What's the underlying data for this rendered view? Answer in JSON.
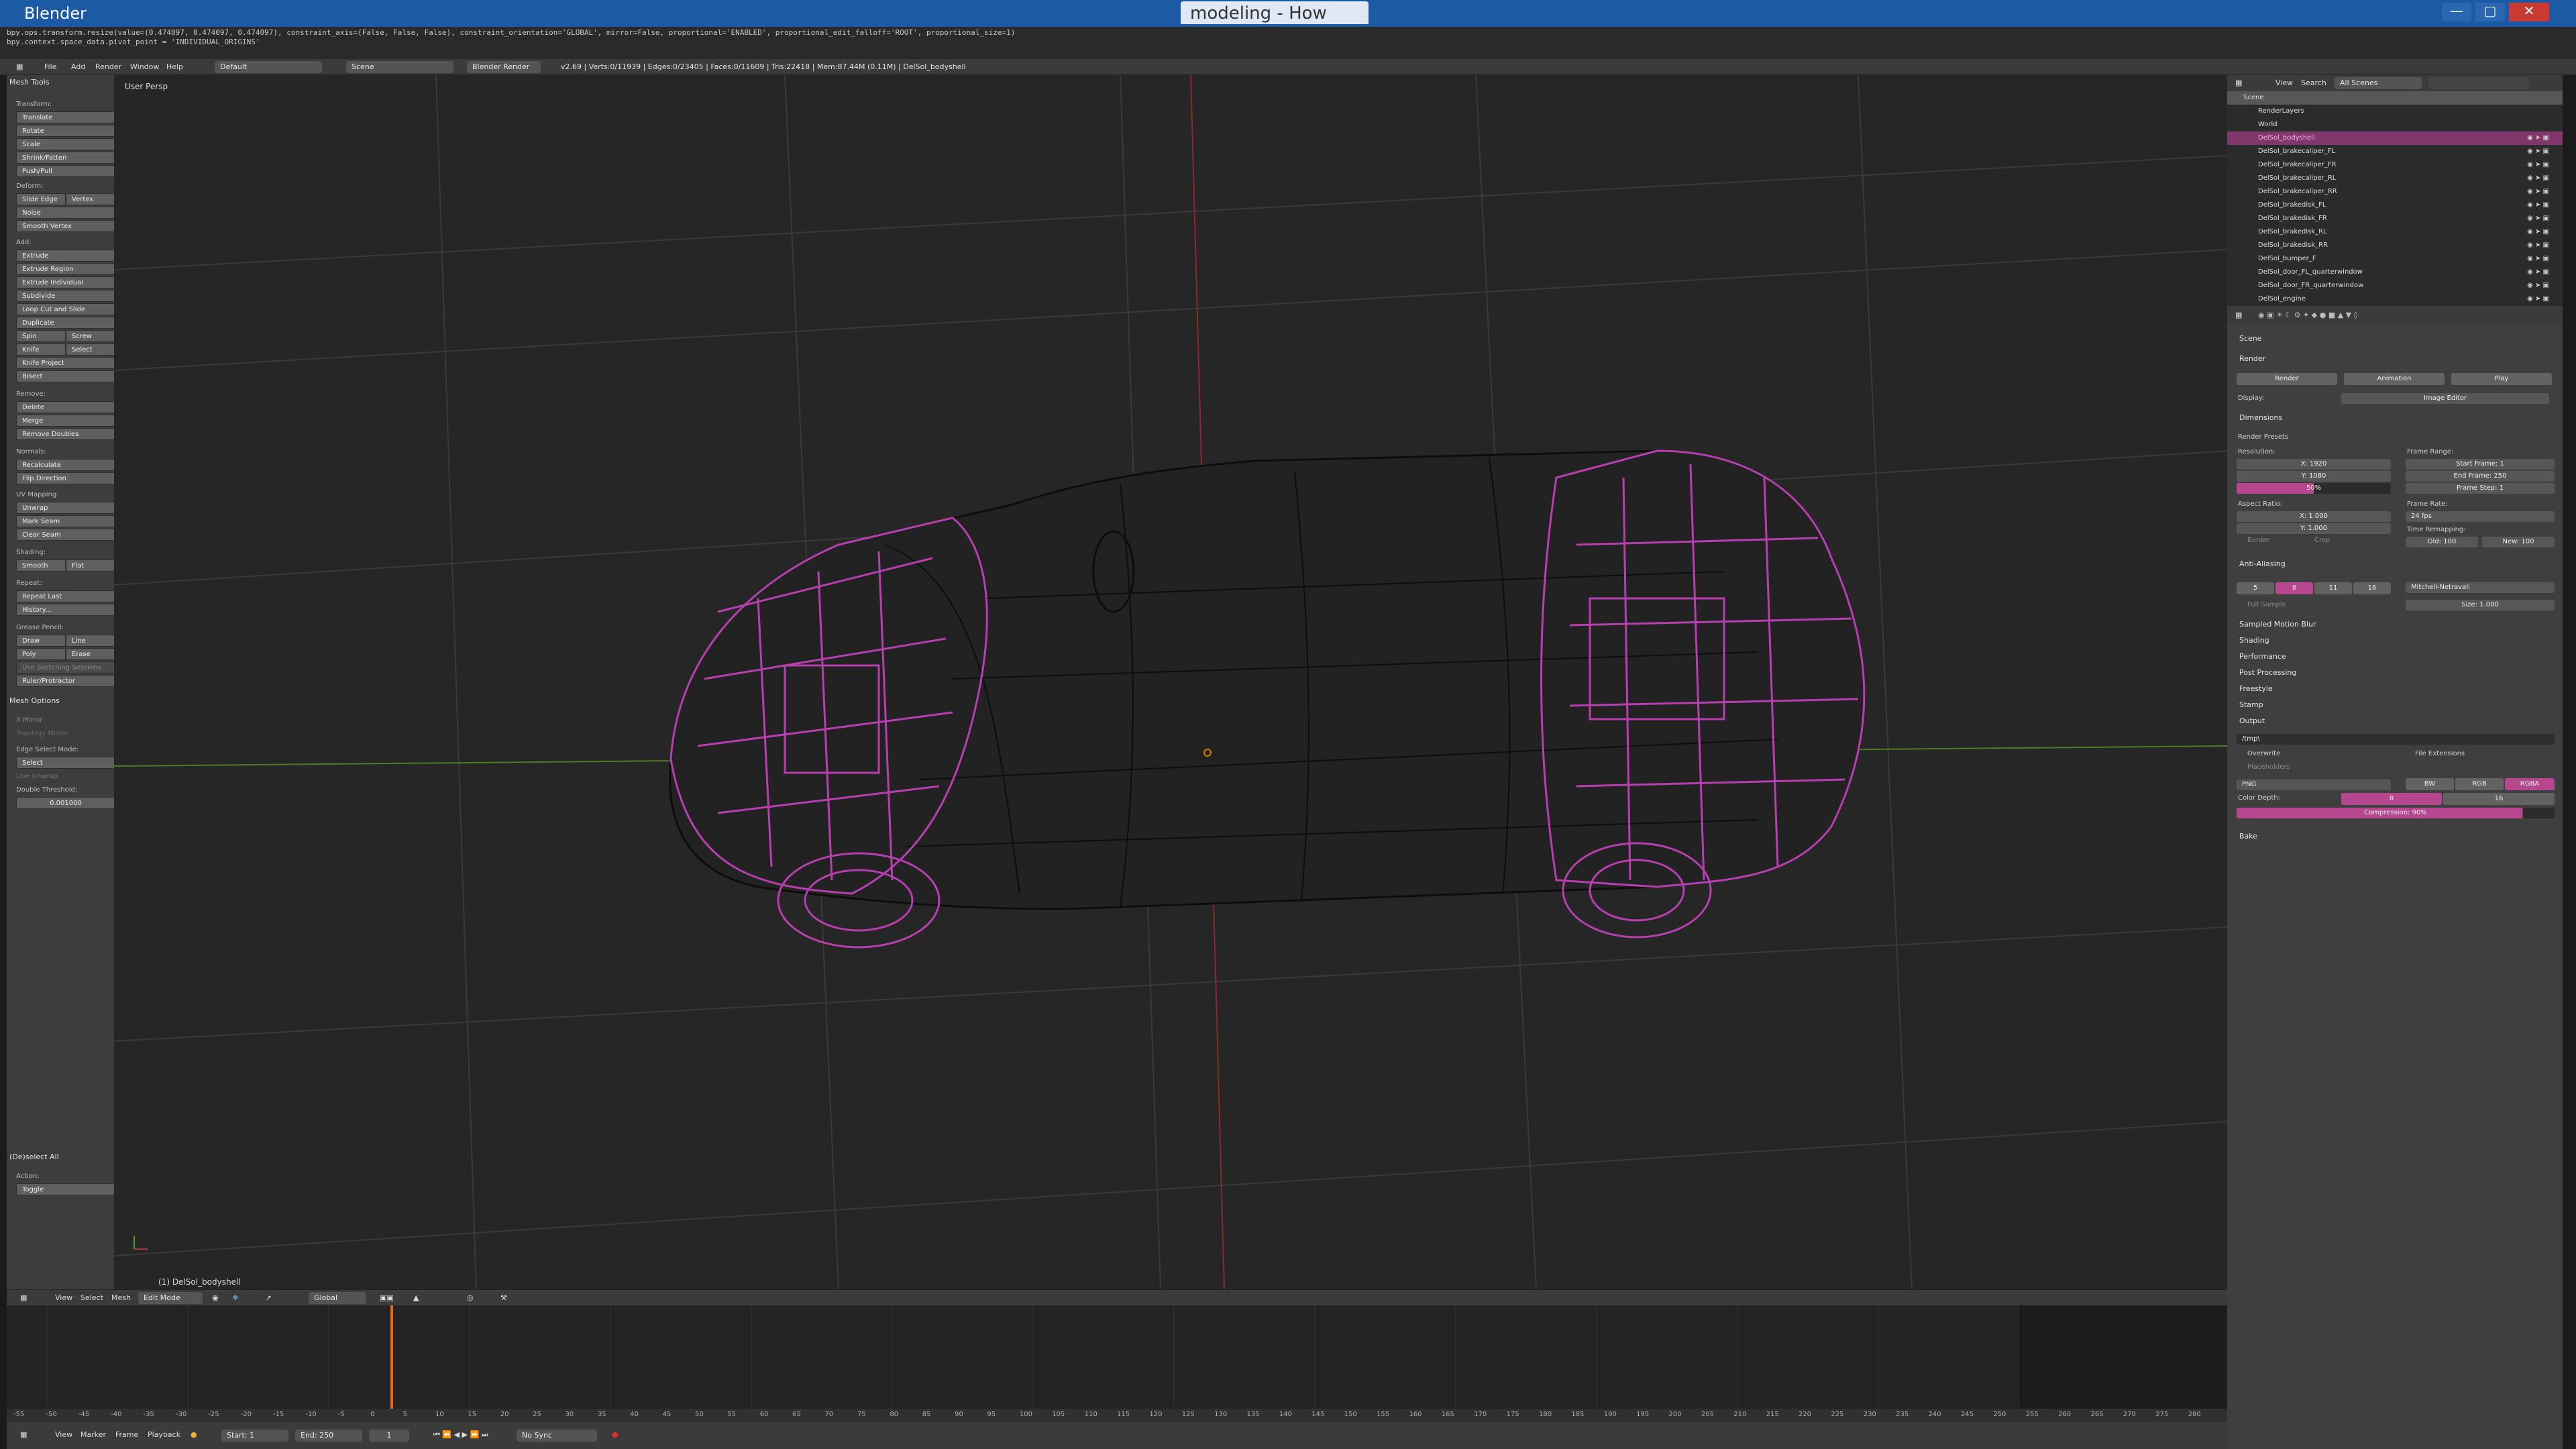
{
  "titlebar": {
    "app_title": "Blender",
    "tabs": [
      "modeling - How"
    ],
    "active_tab": "modeling - How"
  },
  "info": {
    "lines": [
      "bpy.ops.transform.resize(value=(0.474097, 0.474097, 0.474097), constraint_axis=(False, False, False), constraint_orientation='GLOBAL', mirror=False, proportional='ENABLED', proportional_edit_falloff='ROOT', proportional_size=1)",
      "bpy.context.space_data.pivot_point = 'INDIVIDUAL_ORIGINS'"
    ],
    "menus": [
      "File",
      "Add",
      "Render",
      "Window",
      "Help"
    ],
    "layout": "Default",
    "scene": "Scene",
    "engine": "Blender Render",
    "stats": "v2.69 | Verts:0/11939 | Edges:0/23405 | Faces:0/11609 | Tris:22418 | Mem:87.44M (0.11M) | DelSol_bodyshell"
  },
  "toolshelf": {
    "title": "Mesh Tools",
    "transform_label": "Transform:",
    "translate": "Translate",
    "rotate": "Rotate",
    "scale": "Scale",
    "shrink": "Shrink/Fatten",
    "push": "Push/Pull",
    "deform_label": "Deform:",
    "slide_edge": "Slide Edge",
    "vertex": "Vertex",
    "noise": "Noise",
    "smooth_vertex": "Smooth Vertex",
    "add_label": "Add:",
    "extrude": "Extrude",
    "extrude_region": "Extrude Region",
    "extrude_individual": "Extrude Individual",
    "subdivide": "Subdivide",
    "loop_cut": "Loop Cut and Slide",
    "duplicate": "Duplicate",
    "spin": "Spin",
    "screw": "Screw",
    "knife": "Knife",
    "select": "Select",
    "knife_project": "Knife Project",
    "bisect": "Bisect",
    "remove_label": "Remove:",
    "delete": "Delete",
    "merge": "Merge",
    "remove_doubles": "Remove Doubles",
    "normals_label": "Normals:",
    "recalculate": "Recalculate",
    "flip_direction": "Flip Direction",
    "uv_label": "UV Mapping:",
    "unwrap": "Unwrap",
    "mark_seam": "Mark Seam",
    "clear_seam": "Clear Seam",
    "shading_label": "Shading:",
    "smooth": "Smooth",
    "flat": "Flat",
    "repeat_label": "Repeat:",
    "repeat_last": "Repeat Last",
    "history": "History...",
    "grease_label": "Grease Pencil:",
    "draw": "Draw",
    "line": "Line",
    "poly": "Poly",
    "erase": "Erase",
    "use_sketching": "Use Sketching Sessions",
    "ruler": "Ruler/Protractor",
    "mesh_options": "Mesh Options",
    "x_mirror": "X Mirror",
    "topology_mirror": "Topology Mirror",
    "edge_select_mode": "Edge Select Mode:",
    "edge_select_value": "Select",
    "live_unwrap": "Live Unwrap",
    "double_threshold": "Double Threshold:",
    "double_threshold_value": "0.001000",
    "deselect_all": "(De)select All",
    "action_label": "Action:",
    "action_value": "Toggle"
  },
  "viewport": {
    "label": "User Persp",
    "object": "(1) DelSol_bodyshell"
  },
  "vpheader": {
    "menus": [
      "View",
      "Select",
      "Mesh"
    ],
    "mode": "Edit Mode",
    "orientation": "Global"
  },
  "timeline": {
    "ticks": [
      "-55",
      "-50",
      "-45",
      "-40",
      "-35",
      "-30",
      "-25",
      "-20",
      "-15",
      "-10",
      "-5",
      "0",
      "5",
      "10",
      "15",
      "20",
      "25",
      "30",
      "35",
      "40",
      "45",
      "50",
      "55",
      "60",
      "65",
      "70",
      "75",
      "80",
      "85",
      "90",
      "95",
      "100",
      "105",
      "110",
      "115",
      "120",
      "125",
      "130",
      "135",
      "140",
      "145",
      "150",
      "155",
      "160",
      "165",
      "170",
      "175",
      "180",
      "185",
      "190",
      "195",
      "200",
      "205",
      "210",
      "215",
      "220",
      "225",
      "230",
      "235",
      "240",
      "245",
      "250",
      "255",
      "260",
      "265",
      "270",
      "275",
      "280"
    ],
    "menus": [
      "View",
      "Marker",
      "Frame",
      "Playback"
    ],
    "start": "Start: 1",
    "end": "End: 250",
    "current": "1",
    "sync": "No Sync"
  },
  "outliner": {
    "menus": [
      "View",
      "Search"
    ],
    "scene_select": "All Scenes",
    "rows": [
      "Scene",
      "RenderLayers",
      "World",
      "DelSol_bodyshell",
      "DelSol_brakecaliper_FL",
      "DelSol_brakecaliper_FR",
      "DelSol_brakecaliper_RL",
      "DelSol_brakecaliper_RR",
      "DelSol_brakedisk_FL",
      "DelSol_brakedisk_FR",
      "DelSol_brakedisk_RL",
      "DelSol_brakedisk_RR",
      "DelSol_bumper_F",
      "DelSol_door_FL_quarterwindow",
      "DelSol_door_FR_quarterwindow",
      "DelSol_engine"
    ]
  },
  "properties": {
    "scene": "Scene",
    "render_sec": "Render",
    "render_btn": "Render",
    "animation_btn": "Animation",
    "play_btn": "Play",
    "display_label": "Display:",
    "display_value": "Image Editor",
    "dimensions": "Dimensions",
    "render_presets": "Render Presets",
    "resolution": "Resolution:",
    "res_x": "X: 1920",
    "res_y": "Y: 1080",
    "res_pct": "50%",
    "frame_range": "Frame Range:",
    "start_frame": "Start Frame: 1",
    "end_frame": "End Frame: 250",
    "frame_step": "Frame Step: 1",
    "aspect_ratio": "Aspect Ratio:",
    "asp_x": "X: 1.000",
    "asp_y": "Y: 1.000",
    "frame_rate": "Frame Rate:",
    "fps": "24 fps",
    "border": "Border",
    "crop": "Crop",
    "time_remap": "Time Remapping:",
    "old": "Old: 100",
    "new": "New: 100",
    "anti_aliasing": "Anti-Aliasing",
    "aa_samples": [
      "5",
      "8",
      "11",
      "16"
    ],
    "aa_active": "8",
    "filter": "Mitchell-Netravali",
    "full_sample": "Full Sample",
    "size": "Size: 1.000",
    "panels": [
      "Sampled Motion Blur",
      "Shading",
      "Performance",
      "Post Processing",
      "Freestyle",
      "Stamp"
    ],
    "output": "Output",
    "output_path": "/tmp\\",
    "overwrite": "Overwrite",
    "file_extensions": "File Extensions",
    "placeholders": "Placeholders",
    "format": "PNG",
    "bw": "BW",
    "rgb": "RGB",
    "rgba": "RGBA",
    "color_depth": "Color Depth:",
    "depth_8": "8",
    "depth_16": "16",
    "compression": "Compression: 90%",
    "bake": "Bake"
  },
  "colors": {
    "selected_wire": "#b73fb0",
    "wire": "#0d0d0d",
    "accent": "#b5478f"
  }
}
